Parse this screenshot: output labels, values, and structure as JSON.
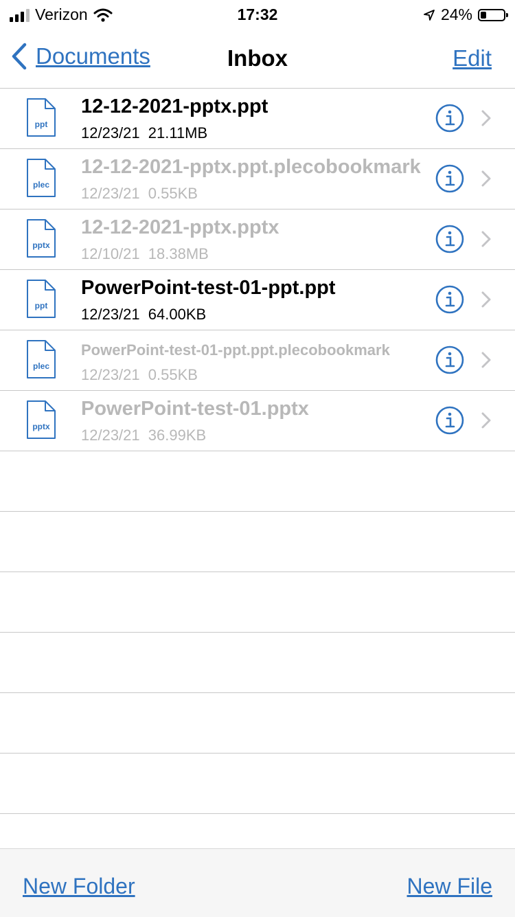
{
  "status_bar": {
    "carrier": "Verizon",
    "time": "17:32",
    "battery": "24%",
    "battery_level": 0.24
  },
  "nav": {
    "back_label": "Documents",
    "title": "Inbox",
    "edit_label": "Edit"
  },
  "files": [
    {
      "name": "12-12-2021-pptx.ppt",
      "date": "12/23/21",
      "size": "21.11MB",
      "icon_label": "ppt",
      "dimmed": false
    },
    {
      "name": "12-12-2021-pptx.ppt.plecobookmark",
      "date": "12/23/21",
      "size": "0.55KB",
      "icon_label": "plec",
      "dimmed": true
    },
    {
      "name": "12-12-2021-pptx.pptx",
      "date": "12/10/21",
      "size": "18.38MB",
      "icon_label": "pptx",
      "dimmed": true
    },
    {
      "name": "PowerPoint-test-01-ppt.ppt",
      "date": "12/23/21",
      "size": "64.00KB",
      "icon_label": "ppt",
      "dimmed": false
    },
    {
      "name": "PowerPoint-test-01-ppt.ppt.plecobookmark",
      "date": "12/23/21",
      "size": "0.55KB",
      "icon_label": "plec",
      "dimmed": true
    },
    {
      "name": "PowerPoint-test-01.pptx",
      "date": "12/23/21",
      "size": "36.99KB",
      "icon_label": "pptx",
      "dimmed": true
    }
  ],
  "toolbar": {
    "new_folder_label": "New Folder",
    "new_file_label": "New File"
  },
  "colors": {
    "accent": "#2f73c0",
    "dimmed_text": "#b8b8b8",
    "separator": "#c8c8c8"
  }
}
